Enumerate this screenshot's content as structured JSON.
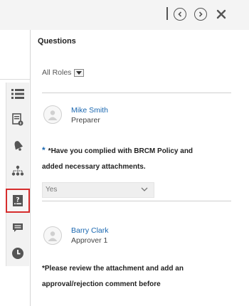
{
  "toolbar": {
    "prev_icon": "chevron-left-icon",
    "next_icon": "chevron-right-icon",
    "close_icon": "close-icon"
  },
  "rail": {
    "items": [
      {
        "name": "list",
        "icon": "list-icon"
      },
      {
        "name": "details",
        "icon": "document-info-icon"
      },
      {
        "name": "alerts",
        "icon": "bell-icon"
      },
      {
        "name": "hierarchy",
        "icon": "hierarchy-icon"
      },
      {
        "name": "questions",
        "icon": "question-icon",
        "active": true
      },
      {
        "name": "comments",
        "icon": "comment-icon"
      },
      {
        "name": "history",
        "icon": "clock-icon"
      }
    ]
  },
  "panel": {
    "title": "Questions",
    "roles_filter": "All Roles",
    "entries": [
      {
        "user_name": "Mike Smith",
        "user_role": "Preparer",
        "question_line1": "*Have you complied with BRCM Policy and",
        "question_line2": "added necessary attachments.",
        "answer": "Yes"
      },
      {
        "user_name": "Barry Clark",
        "user_role": "Approver 1",
        "question_line1": "*Please review the attachment and add an",
        "question_line2": "approval/rejection comment before"
      }
    ],
    "required_marker": "*"
  },
  "colors": {
    "accent": "#1a67b0",
    "active_outline": "#d62d2d"
  }
}
